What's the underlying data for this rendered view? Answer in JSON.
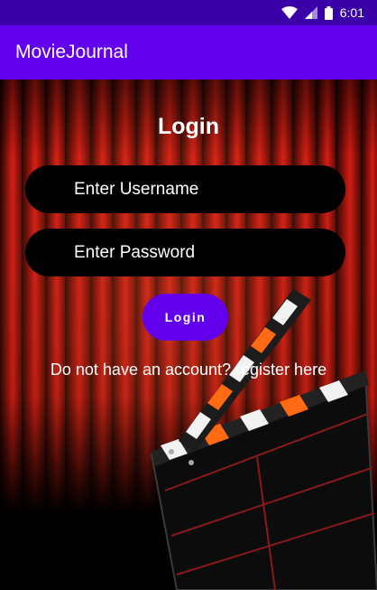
{
  "status_bar": {
    "time": "6:01",
    "icons": [
      "wifi-icon",
      "signal-icon",
      "battery-icon"
    ]
  },
  "app_bar": {
    "title": "MovieJournal"
  },
  "login": {
    "title": "Login",
    "username_placeholder": "Enter Username",
    "password_placeholder": "Enter Password",
    "button_label": "Login",
    "register_text": "Do not have an account? register here"
  },
  "colors": {
    "status_bar": "#3a01a8",
    "app_bar": "#6200ee",
    "button": "#6200ee",
    "field_background": "#000000",
    "curtain": "#b01010"
  }
}
